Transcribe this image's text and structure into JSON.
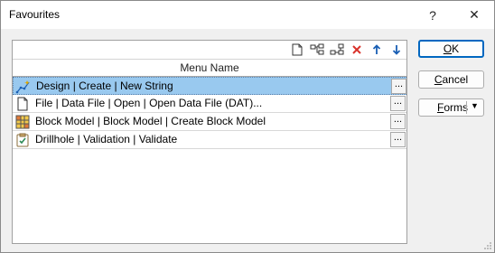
{
  "window": {
    "title": "Favourites",
    "help_glyph": "?",
    "close_glyph": "✕"
  },
  "toolbar": {
    "icons": [
      "new-document-icon",
      "insert-tree-icon",
      "append-tree-icon",
      "delete-icon",
      "move-up-icon",
      "move-down-icon"
    ],
    "delete_color": "#d9322b",
    "arrow_color": "#1a5fb4"
  },
  "table": {
    "column_header": "Menu Name",
    "rows": [
      {
        "label": "Design | Create | New String",
        "icon": "new-string-icon",
        "selected": true,
        "button": "..."
      },
      {
        "label": "File | Data File | Open | Open Data File (DAT)...",
        "icon": "document-icon",
        "selected": false,
        "button": "..."
      },
      {
        "label": "Block Model | Block Model | Create Block Model",
        "icon": "block-model-icon",
        "selected": false,
        "button": "..."
      },
      {
        "label": "Drillhole | Validation | Validate",
        "icon": "validate-icon",
        "selected": false,
        "button": "..."
      }
    ],
    "selected_color": "#99c9ef"
  },
  "buttons": {
    "ok": {
      "before": "",
      "mnemonic": "O",
      "after": "K"
    },
    "cancel": {
      "before": "",
      "mnemonic": "C",
      "after": "ancel"
    },
    "forms": {
      "before": "",
      "mnemonic": "F",
      "after": "orms"
    },
    "forms_arrow": "▼"
  },
  "accent_color": "#0067c0"
}
